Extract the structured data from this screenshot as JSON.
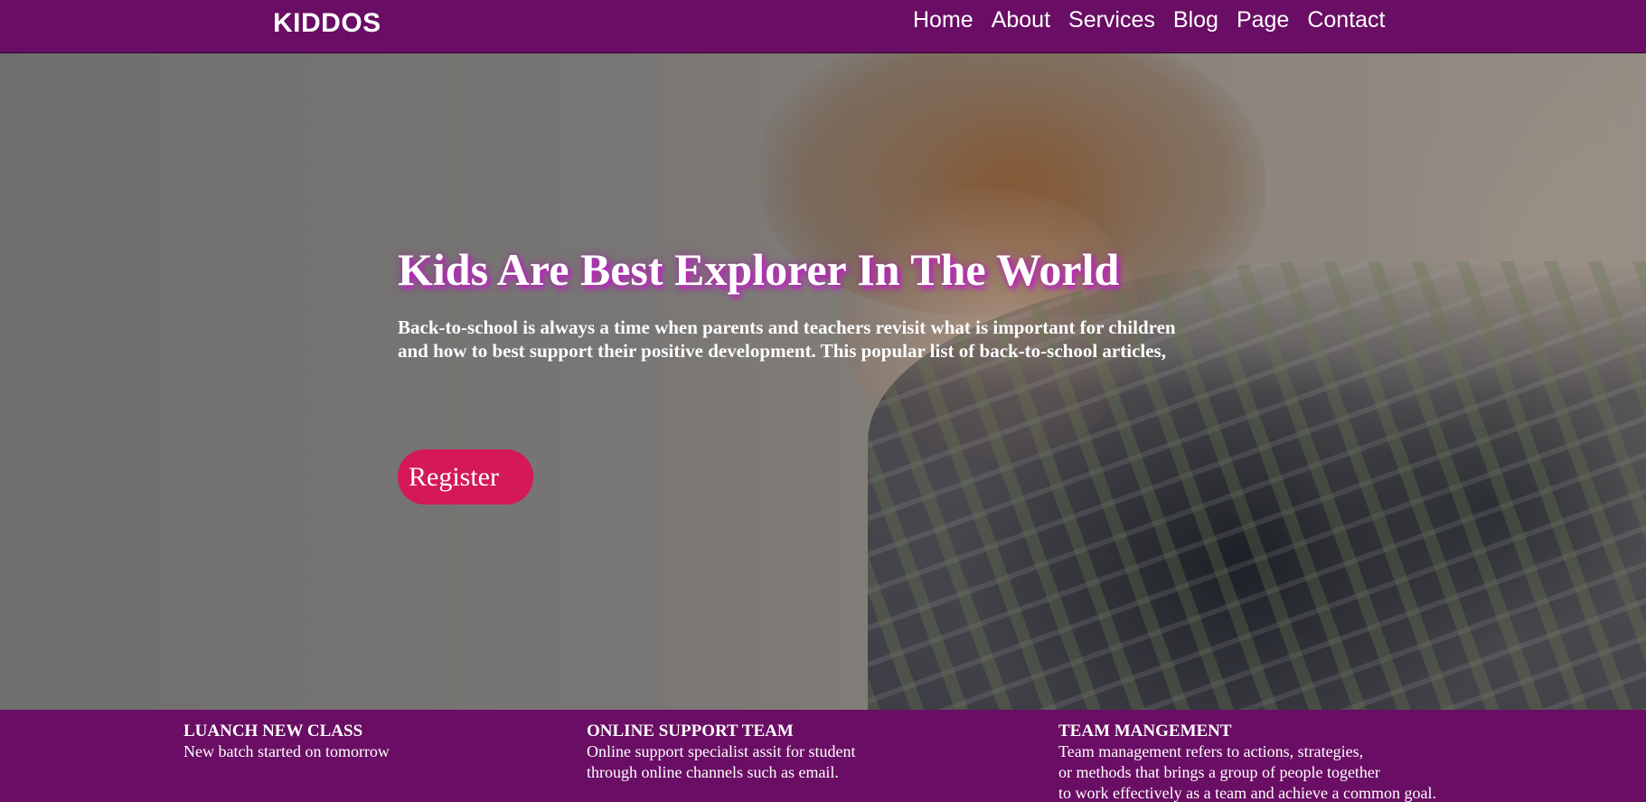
{
  "header": {
    "brand": "KIDDOS",
    "nav": [
      "Home",
      "About",
      "Services",
      "Blog",
      "Page",
      "Contact"
    ]
  },
  "hero": {
    "title": "Kids Are Best Explorer In The World",
    "text_line1": "Back-to-school is always a time when parents and teachers revisit what is important for children",
    "text_line2": "and how to best support their positive development. This popular list of back-to-school articles,",
    "register_label": "Register"
  },
  "features": [
    {
      "title": "LUANCH NEW CLASS",
      "lines": [
        "New batch started on tomorrow"
      ]
    },
    {
      "title": "ONLINE SUPPORT TEAM",
      "lines": [
        "Online support specialist assit for student",
        "through online channels such as email."
      ]
    },
    {
      "title": "TEAM MANGEMENT",
      "lines": [
        "Team management refers to actions, strategies,",
        "or methods that brings a group of people together",
        "to work effectively as a team and achieve a common goal."
      ]
    }
  ],
  "colors": {
    "brand_purple": "#6a0d64",
    "register_pink": "#d4185a",
    "title_glow": "#c21fc7"
  }
}
